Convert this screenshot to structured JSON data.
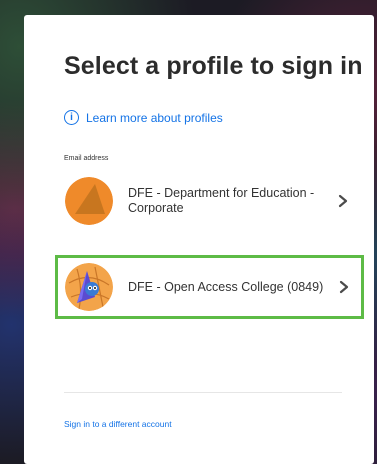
{
  "dialog": {
    "title": "Select a profile to sign in",
    "learn_more": "Learn more about profiles",
    "email_label": "Email address",
    "profiles": [
      {
        "name": "DFE - Department for Education - Corporate",
        "avatar_icon": "orange-triangle-avatar",
        "selected": false
      },
      {
        "name": "DFE - Open Access College (0849)",
        "avatar_icon": "mascot-avatar",
        "selected": true
      }
    ],
    "sign_in_other": "Sign in to a different account"
  },
  "colors": {
    "link": "#1473e6",
    "highlight": "#5dbb46",
    "avatar_orange": "#ef8a2a"
  }
}
